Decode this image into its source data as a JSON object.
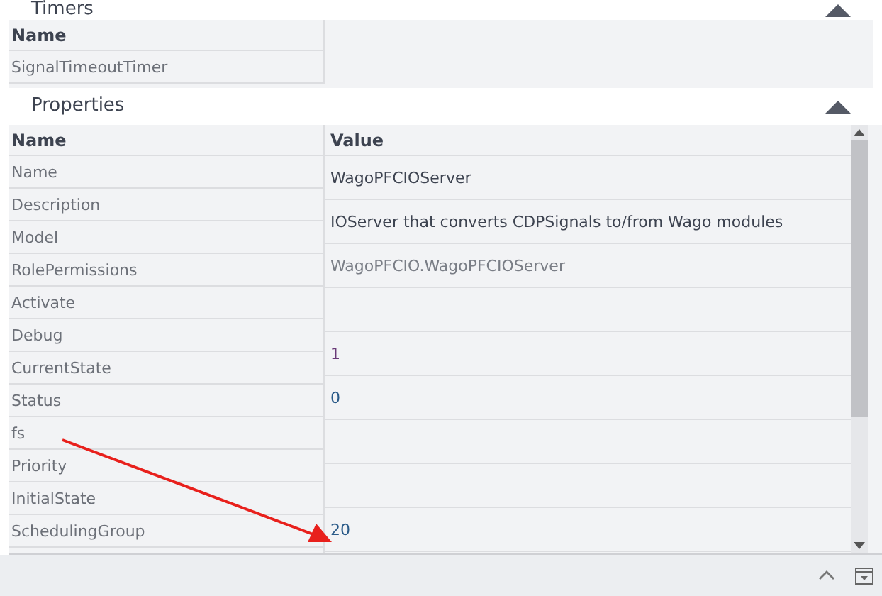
{
  "timers": {
    "title": "Timers",
    "expanded": true,
    "columns": [
      "Name"
    ],
    "rows": [
      "SignalTimeoutTimer"
    ]
  },
  "properties": {
    "title": "Properties",
    "expanded": true,
    "columns": [
      "Name",
      "Value"
    ],
    "names": [
      "Name",
      "Description",
      "Model",
      "RolePermissions",
      "Activate",
      "Debug",
      "CurrentState",
      "Status",
      "fs",
      "Priority",
      "InitialState",
      "SchedulingGroup"
    ],
    "values": [
      {
        "text": "WagoPFCIOServer",
        "kind": "text"
      },
      {
        "text": "IOServer that converts CDPSignals to/from Wago modules",
        "kind": "text"
      },
      {
        "text": "WagoPFCIO.WagoPFCIOServer",
        "kind": "readonly"
      },
      {
        "kind": "text"
      },
      {
        "text": "1",
        "kind": "state"
      },
      {
        "text": "0",
        "kind": "number"
      },
      {
        "kind": "text"
      },
      {
        "kind": "text"
      },
      {
        "text": "20",
        "kind": "number"
      }
    ]
  }
}
